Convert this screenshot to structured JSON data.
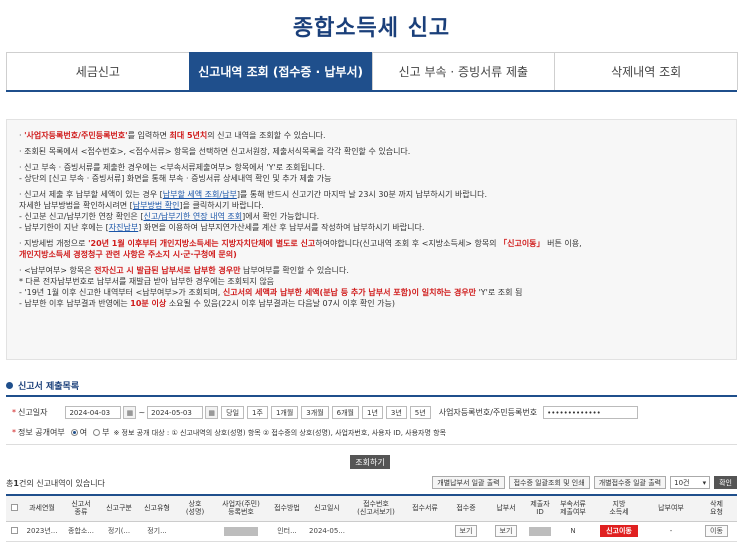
{
  "page": {
    "title": "종합소득세 신고"
  },
  "tabs": [
    {
      "label": "세금신고"
    },
    {
      "label": "신고내역 조회 (접수증 · 납부서)"
    },
    {
      "label": "신고 부속 · 증빙서류 제출"
    },
    {
      "label": "삭제내역 조회"
    }
  ],
  "notice": {
    "l1a": "'사업자등록번호/주민등록번호'",
    "l1b": "를 입력하면 ",
    "l1c": "최대 5년치",
    "l1d": "의 신고 내역을 조회할 수 있습니다.",
    "l2": "· 조회된 목록에서 <접수번호>, <접수서류> 항목을 선택하면 신고서원장, 제출서식목록을 각각 확인할 수 있습니다.",
    "l3": "· 신고 부속 · 증빙서류를 제출한 경우에는 <부속서류제출여부> 항목에서 'Y'로 조회됩니다.",
    "l4": "  - 상단의 [신고 부속 · 증빙서류] 화면을 통해 부속 · 증빙서류 상세내역 확인 및 추가 제출 가능",
    "l5a": "· 신고서 제출 후 납부할 세액이 있는 경우 [",
    "l5b": "납부할 세액 조회/납부",
    "l5c": "]를 통해 반드시 신고기간 마지막 날 23시 30분 까지 납부하시기 바랍니다.",
    "l6a": "  자세한 납부방법을 확인하시려면 [",
    "l6b": "납부방법 확인",
    "l6c": "]을 클릭하시기 바랍니다.",
    "l7a": "  - 신고분 신고/납부기한 연장 확인은 [",
    "l7b": "신고/납부기한 연장 내역 조회",
    "l7c": "]에서 확인 가능합니다.",
    "l8a": "  - 납부기한이 지난 후에는 [",
    "l8b": "자진납부",
    "l8c": "] 화면을 이용하여 납부지연가산세를 계산 후 납부서를 작성하여 납부하시기 바랍니다.",
    "l9a": "· 지방세법 개정으로 ",
    "l9b": "'20년 1월 이후부터 개인지방소득세는 지방자치단체에 별도로 신고",
    "l9c": "하여야합니다(신고내역 조회 후 <지방소득세> 항목의 ",
    "l9d": "「신고이동」",
    "l9e": " 버튼 이용,",
    "l10": "  개인지방소득세 경정청구 관련 사항은 주소지 시·군·구청에 문의)",
    "l11a": "· <납부여부> 항목은 ",
    "l11b": "전자신고 시 발급된 납부서로 납부한 경우만",
    "l11c": " 납부여부를 확인할 수 있습니다.",
    "l12": "  * 다른 전자납부번호로 납부서를 재발급 받아 납부한 경우에는 조회되지 않음",
    "l13a": "  - '19년 1월 이후 신고한 내역부터 <납부여부>가 조회되며, ",
    "l13b": "신고서의 세액과 납부한 세액(분납 등 추가 납부서 포함)이 일치하는 경우만",
    "l13c": " 'Y'로 조회 됨",
    "l14a": "  - 납부한 이후 납부결과 반영에는 ",
    "l14b": "10분 이상",
    "l14c": " 소요될 수 있음(22시 이후 납부결과는 다음날 07시 이후 확인 가능)"
  },
  "section": {
    "title": "신고서 제출목록"
  },
  "search": {
    "date_label": "신고일자",
    "date_from": "2024-04-03",
    "date_sep": "~",
    "date_to": "2024-05-03",
    "periods": [
      "당일",
      "1주",
      "1개월",
      "3개월",
      "6개월",
      "1년",
      "3년",
      "5년"
    ],
    "id_label": "사업자등록번호/주민등록번호",
    "id_value": "•••••••••••••",
    "disclose_label": "정보 공개여부",
    "opt_yes": "여",
    "opt_no": "부",
    "disclose_note": "※ 정보 공개 대상 : ① 신고내역의 상호(성명) 항목 ② 접수증의 상호(성명), 사업자번호, 사용자 ID, 사용자명 항목",
    "query_button": "조회하기"
  },
  "results": {
    "count_prefix": "총",
    "count": "1",
    "count_suffix": "건의 신고내역이 있습니다",
    "actions": [
      "개별납부서 일괄 출력",
      "접수증 일괄조회 및 인쇄",
      "개별접수증 일괄 출력"
    ],
    "page_size": "10건",
    "ok_button": "확인"
  },
  "table": {
    "headers": [
      "",
      "과세연월",
      "신고서\n종류",
      "신고구분",
      "신고유형",
      "상호\n(성명)",
      "사업자(주민)\n등록번호",
      "접수방법",
      "신고일시",
      "접수번호\n(신고서보기)",
      "접수서류",
      "접수증",
      "납부서",
      "제출자\nID",
      "부속서류\n제출여부",
      "지방\n소득세",
      "납부여부",
      "삭제\n요청"
    ],
    "row": {
      "period": "2023년...",
      "type": "종합소...",
      "category": "정기(...",
      "kind": "정기...",
      "method": "인터...",
      "date": "2024-05...",
      "receipt_btn": "보기",
      "payment_btn": "보기",
      "attach": "N",
      "local_tax_btn": "신고이동",
      "paid": "-",
      "delete_btn": "이동"
    }
  },
  "colors": {
    "primary": "#1f4f8c",
    "alert": "#d01c1c",
    "local_tax_button": "#e02020"
  },
  "icons": {
    "calendar": "calendar-icon",
    "chevron": "chevron-down-icon",
    "section": "bullet-icon"
  }
}
